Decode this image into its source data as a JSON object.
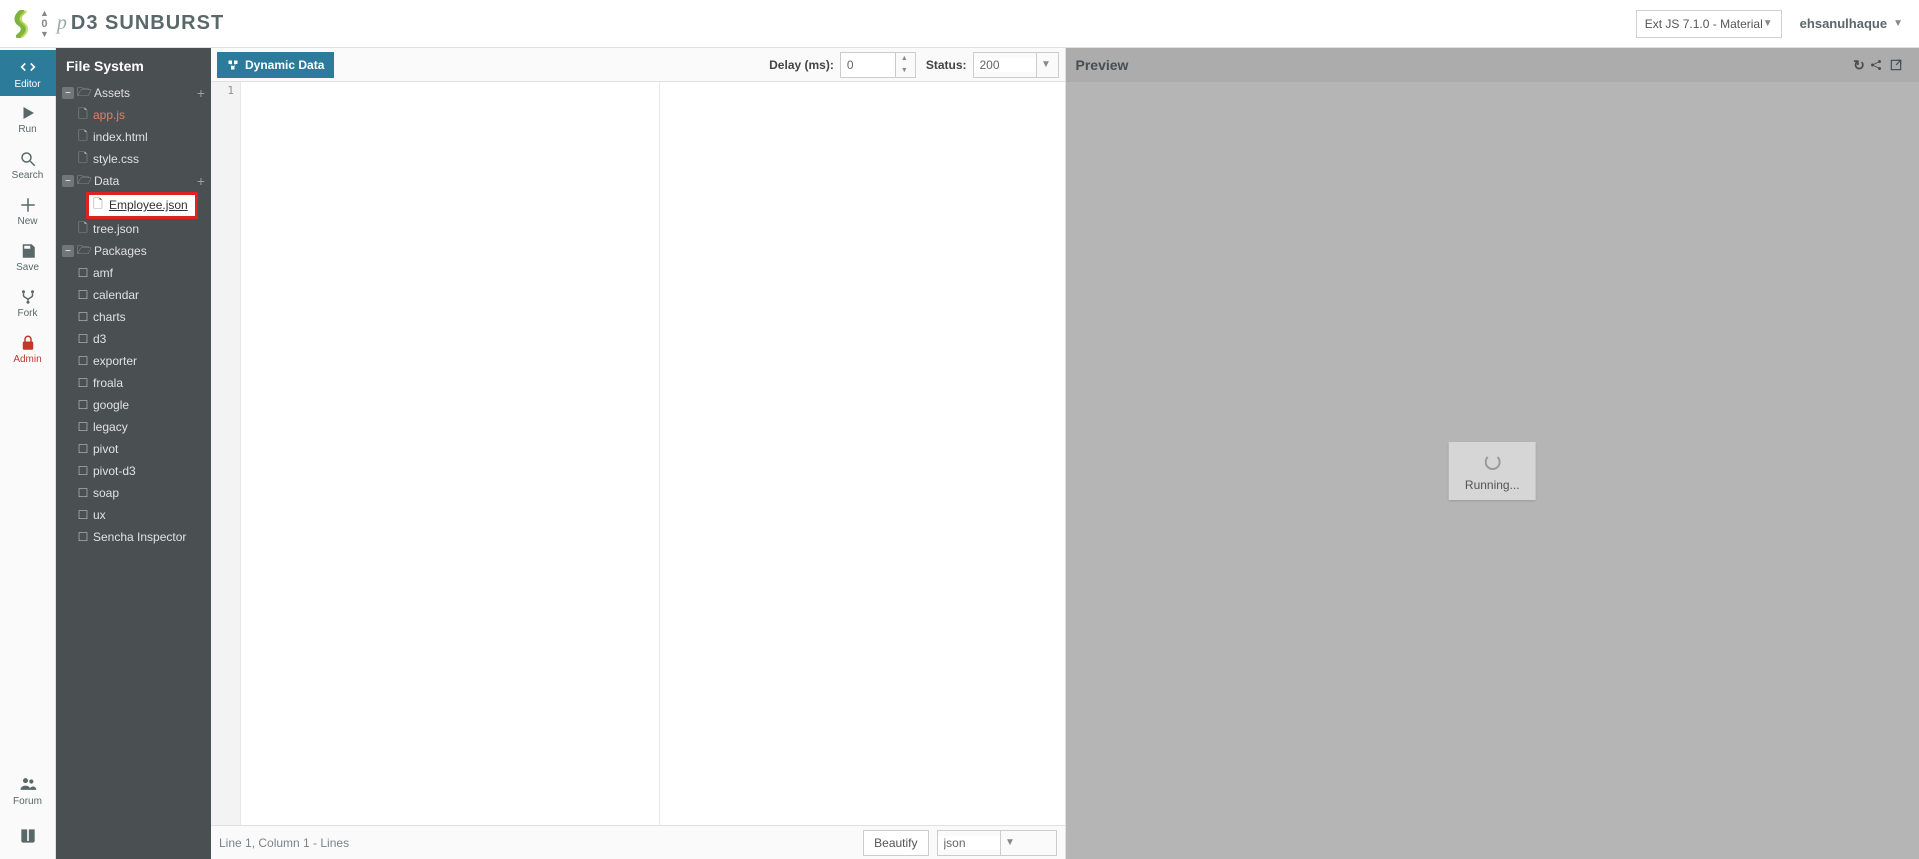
{
  "header": {
    "vote_count": "0",
    "fork_symbol": "p",
    "title": "D3 SUNBURST",
    "framework": "Ext JS 7.1.0 - Material",
    "username": "ehsanulhaque"
  },
  "toolbar": {
    "editor": "Editor",
    "run": "Run",
    "search": "Search",
    "new": "New",
    "save": "Save",
    "fork": "Fork",
    "admin": "Admin",
    "forum": "Forum"
  },
  "fs": {
    "header": "File System",
    "folders": {
      "assets": "Assets",
      "data": "Data",
      "packages": "Packages"
    },
    "files": {
      "appjs": "app.js",
      "indexhtml": "index.html",
      "stylecss": "style.css",
      "employee_edit": "Employee.json",
      "treejson": "tree.json",
      "sencha_inspector": "Sencha Inspector"
    },
    "packages": [
      "amf",
      "calendar",
      "charts",
      "d3",
      "exporter",
      "froala",
      "google",
      "legacy",
      "pivot",
      "pivot-d3",
      "soap",
      "ux"
    ]
  },
  "editor": {
    "dynamic_data": "Dynamic Data",
    "delay_label": "Delay (ms):",
    "delay_value": "0",
    "status_label": "Status:",
    "status_value": "200",
    "gutter_line": "1",
    "status_text": "Line 1, Column 1 - Lines",
    "beautify": "Beautify",
    "lang": "json"
  },
  "preview": {
    "title": "Preview",
    "loading": "Running..."
  }
}
